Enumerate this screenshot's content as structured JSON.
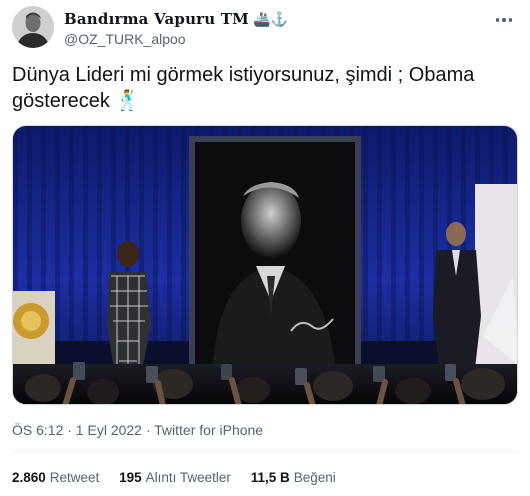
{
  "author": {
    "display_name": "Bandırma Vapuru TM",
    "name_emoji": "🚢⚓",
    "handle": "@OZ_TURK_alpoo"
  },
  "tweet": {
    "text": "Dünya Lideri mi görmek istiyorsunuz, şimdi ; Obama gösterecek 🕺"
  },
  "meta": {
    "time": "ÖS 6:12",
    "date": "1 Eyl 2022",
    "source": "Twitter for iPhone",
    "line": "ÖS 6:12 · 1 Eyl 2022 · Twitter for iPhone"
  },
  "stats": {
    "retweets_count": "2.860",
    "retweets_label": "Retweet",
    "quotes_count": "195",
    "quotes_label": "Alıntı Tweetler",
    "likes_count": "11,5 B",
    "likes_label": "Beğeni"
  },
  "icons": {
    "more": "more-horizontal-icon"
  },
  "colors": {
    "text_primary": "#0f1419",
    "text_secondary": "#536471",
    "border": "#cfd9de",
    "stage_curtain": "#17289a"
  }
}
